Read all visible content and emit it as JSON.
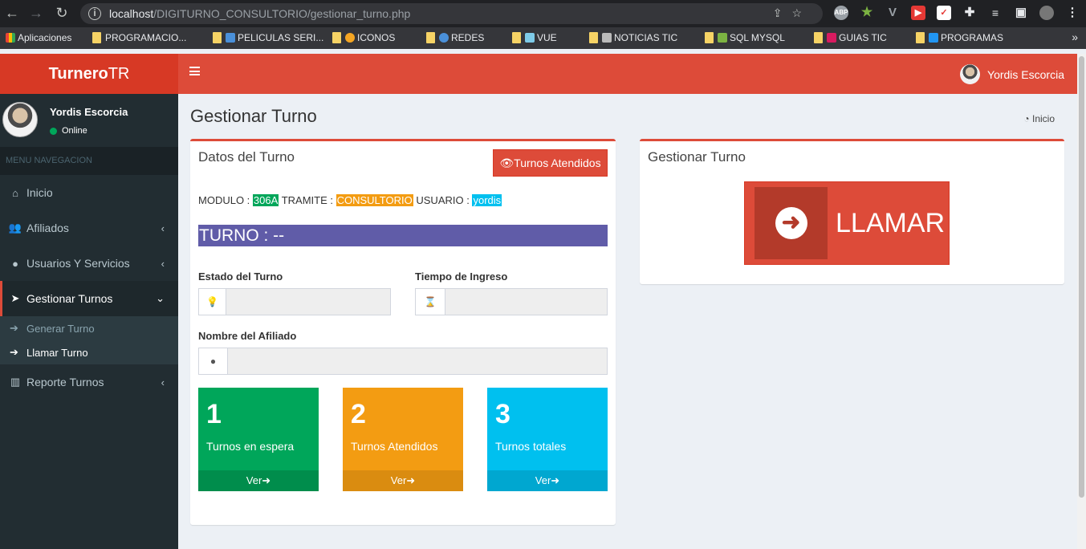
{
  "browser": {
    "url_host": "localhost",
    "url_path": "/DIGITURNO_CONSULTORIO/gestionar_turno.php",
    "bookmarks": [
      {
        "label": "Aplicaciones"
      },
      {
        "label": "PROGRAMACIO..."
      },
      {
        "label": "PELICULAS SERI..."
      },
      {
        "label": "ICONOS"
      },
      {
        "label": "REDES"
      },
      {
        "label": "VUE"
      },
      {
        "label": "NOTICIAS TIC"
      },
      {
        "label": "SQL MYSQL"
      },
      {
        "label": "GUIAS TIC"
      },
      {
        "label": "PROGRAMAS"
      }
    ]
  },
  "sidebar": {
    "logo_bold": "Turnero",
    "logo_rest": "TR",
    "user_name": "Yordis Escorcia",
    "user_status": "Online",
    "menu_header": "MENU NAVEGACION",
    "items": [
      {
        "label": "Inicio",
        "icon": "dashboard-icon"
      },
      {
        "label": "Afiliados",
        "icon": "users-icon"
      },
      {
        "label": "Usuarios Y Servicios",
        "icon": "user-icon"
      },
      {
        "label": "Gestionar Turnos",
        "icon": "paper-plane-icon"
      },
      {
        "label": "Reporte Turnos",
        "icon": "bar-chart-icon"
      }
    ],
    "subitems": [
      {
        "label": "Generar Turno"
      },
      {
        "label": "Llamar Turno"
      }
    ]
  },
  "topbar": {
    "user_name": "Yordis Escorcia"
  },
  "page": {
    "title": "Gestionar Turno",
    "breadcrumb": "Inicio"
  },
  "datos": {
    "title": "Datos del Turno",
    "button_label": "Turnos Atendidos",
    "modulo_label": "MODULO :",
    "modulo_value": "306A",
    "tramite_label": "TRAMITE :",
    "tramite_value": "CONSULTORIO",
    "usuario_label": "USUARIO :",
    "usuario_value": "yordis",
    "turno_text": "TURNO : --",
    "estado_label": "Estado del Turno",
    "estado_value": "",
    "tiempo_label": "Tiempo de Ingreso",
    "tiempo_value": "",
    "nombre_label": "Nombre del Afiliado",
    "nombre_value": ""
  },
  "tiles": [
    {
      "num": "1",
      "label": "Turnos en espera",
      "link": "Ver",
      "color": "#00a65a",
      "foot_color": "#008d4c"
    },
    {
      "num": "2",
      "label": "Turnos Atendidos",
      "link": "Ver",
      "color": "#f39c12",
      "foot_color": "#da8c10"
    },
    {
      "num": "3",
      "label": "Turnos totales",
      "link": "Ver",
      "color": "#00c0ef",
      "foot_color": "#00a7d0"
    }
  ],
  "gestionar": {
    "title": "Gestionar Turno",
    "call_label": "LLAMAR"
  }
}
